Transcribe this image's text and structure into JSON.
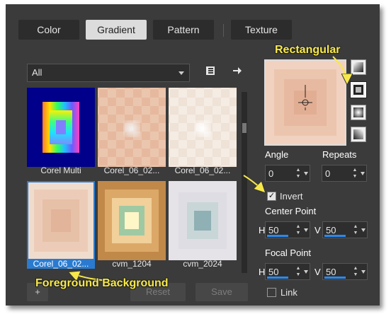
{
  "tabs": [
    {
      "label": "Color",
      "active": false
    },
    {
      "label": "Gradient",
      "active": true
    },
    {
      "label": "Pattern",
      "active": false
    },
    {
      "label": "Texture",
      "active": false
    }
  ],
  "filter": {
    "selected": "All"
  },
  "toolbar_icons": [
    "library-icon",
    "arrow-right-icon"
  ],
  "thumbnails": [
    {
      "label": "Corel Multi",
      "style": "multi",
      "selected": false
    },
    {
      "label": "Corel_06_02...",
      "style": "checker-peach",
      "selected": false
    },
    {
      "label": "Corel_06_02...",
      "style": "checker-light",
      "selected": false
    },
    {
      "label": "Corel_06_02...",
      "style": "rect-peach",
      "selected": true
    },
    {
      "label": "cvm_1204",
      "style": "rect-brown",
      "selected": false
    },
    {
      "label": "cvm_2024",
      "style": "rect-blue",
      "selected": false
    }
  ],
  "bottom_buttons": {
    "add": "+",
    "reset": "Reset",
    "save": "Save"
  },
  "gradient_types": [
    "linear",
    "rectangular",
    "sunburst",
    "corner"
  ],
  "selected_type": "rectangular",
  "angle": {
    "label": "Angle",
    "value": "0"
  },
  "repeats": {
    "label": "Repeats",
    "value": "0"
  },
  "invert": {
    "label": "Invert",
    "checked": true
  },
  "center_point": {
    "label": "Center Point",
    "h_label": "H",
    "h_value": "50",
    "v_label": "V",
    "v_value": "50"
  },
  "focal_point": {
    "label": "Focal Point",
    "h_label": "H",
    "h_value": "50",
    "v_label": "V",
    "v_value": "50"
  },
  "link": {
    "label": "Link",
    "checked": false
  },
  "annotations": {
    "rectangular": "Rectangular",
    "foreground": "Foreground Background"
  },
  "colors": {
    "accent": "#2a7bd0",
    "annotation": "#f7e84a",
    "dialog_bg": "#3b3b3b"
  }
}
